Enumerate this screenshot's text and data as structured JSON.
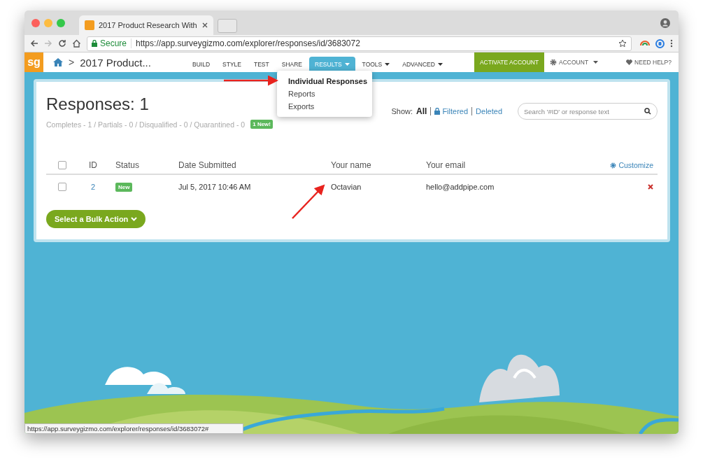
{
  "browser": {
    "tab_title": "2017 Product Research With",
    "security_label": "Secure",
    "url": "https://app.surveygizmo.com/explorer/responses/id/3683072",
    "status_url": "https://app.surveygizmo.com/explorer/responses/id/3683072#"
  },
  "app_nav": {
    "logo": "sg",
    "breadcrumb_separator": ">",
    "survey_title": "2017 Product...",
    "items": [
      {
        "label": "BUILD",
        "selected": false,
        "dropdown": false
      },
      {
        "label": "STYLE",
        "selected": false,
        "dropdown": false
      },
      {
        "label": "TEST",
        "selected": false,
        "dropdown": false
      },
      {
        "label": "SHARE",
        "selected": false,
        "dropdown": false
      },
      {
        "label": "RESULTS",
        "selected": true,
        "dropdown": true
      },
      {
        "label": "TOOLS",
        "selected": false,
        "dropdown": true
      },
      {
        "label": "ADVANCED",
        "selected": false,
        "dropdown": true
      }
    ],
    "activate_button": "ACTIVATE ACCOUNT",
    "account": "ACCOUNT",
    "help": "NEED HELP?"
  },
  "results_menu": [
    {
      "label": "Individual Responses",
      "selected": true
    },
    {
      "label": "Reports",
      "selected": false
    },
    {
      "label": "Exports",
      "selected": false
    }
  ],
  "responses": {
    "title": "Responses: 1",
    "summary": "Completes - 1 / Partials - 0 / Disqualified - 0 / Quarantined - 0",
    "new_badge": "1 New!",
    "show_label": "Show:",
    "filters": [
      {
        "label": "All",
        "selected": true,
        "locked": false
      },
      {
        "label": "Filtered",
        "selected": false,
        "locked": true
      },
      {
        "label": "Deleted",
        "selected": false,
        "locked": false
      }
    ],
    "search": {
      "placeholder": "Search '#ID' or response text"
    },
    "table": {
      "select_all_checked": false,
      "columns": [
        "ID",
        "Status",
        "Date Submitted",
        "Your name",
        "Your email"
      ],
      "customize": "Customize",
      "rows": [
        {
          "checked": false,
          "cells": [
            "2",
            "New",
            "Jul 5, 2017 10:46 AM",
            "Octavian",
            "hello@addpipe.com"
          ]
        }
      ]
    },
    "bulk_action": "Select a Bulk Action"
  }
}
